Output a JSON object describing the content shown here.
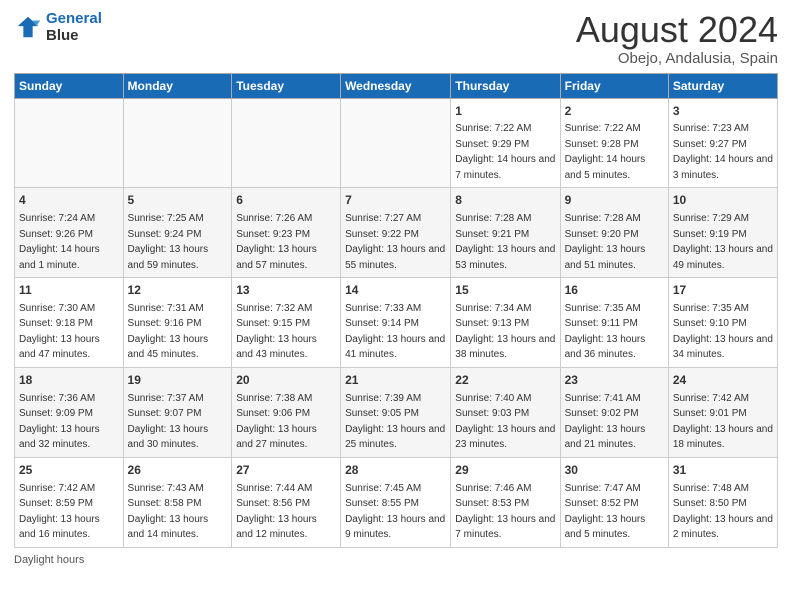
{
  "logo": {
    "line1": "General",
    "line2": "Blue"
  },
  "title": "August 2024",
  "subtitle": "Obejo, Andalusia, Spain",
  "weekdays": [
    "Sunday",
    "Monday",
    "Tuesday",
    "Wednesday",
    "Thursday",
    "Friday",
    "Saturday"
  ],
  "footer": "Daylight hours",
  "weeks": [
    [
      {
        "day": "",
        "sunrise": "",
        "sunset": "",
        "daylight": ""
      },
      {
        "day": "",
        "sunrise": "",
        "sunset": "",
        "daylight": ""
      },
      {
        "day": "",
        "sunrise": "",
        "sunset": "",
        "daylight": ""
      },
      {
        "day": "",
        "sunrise": "",
        "sunset": "",
        "daylight": ""
      },
      {
        "day": "1",
        "sunrise": "Sunrise: 7:22 AM",
        "sunset": "Sunset: 9:29 PM",
        "daylight": "Daylight: 14 hours and 7 minutes."
      },
      {
        "day": "2",
        "sunrise": "Sunrise: 7:22 AM",
        "sunset": "Sunset: 9:28 PM",
        "daylight": "Daylight: 14 hours and 5 minutes."
      },
      {
        "day": "3",
        "sunrise": "Sunrise: 7:23 AM",
        "sunset": "Sunset: 9:27 PM",
        "daylight": "Daylight: 14 hours and 3 minutes."
      }
    ],
    [
      {
        "day": "4",
        "sunrise": "Sunrise: 7:24 AM",
        "sunset": "Sunset: 9:26 PM",
        "daylight": "Daylight: 14 hours and 1 minute."
      },
      {
        "day": "5",
        "sunrise": "Sunrise: 7:25 AM",
        "sunset": "Sunset: 9:24 PM",
        "daylight": "Daylight: 13 hours and 59 minutes."
      },
      {
        "day": "6",
        "sunrise": "Sunrise: 7:26 AM",
        "sunset": "Sunset: 9:23 PM",
        "daylight": "Daylight: 13 hours and 57 minutes."
      },
      {
        "day": "7",
        "sunrise": "Sunrise: 7:27 AM",
        "sunset": "Sunset: 9:22 PM",
        "daylight": "Daylight: 13 hours and 55 minutes."
      },
      {
        "day": "8",
        "sunrise": "Sunrise: 7:28 AM",
        "sunset": "Sunset: 9:21 PM",
        "daylight": "Daylight: 13 hours and 53 minutes."
      },
      {
        "day": "9",
        "sunrise": "Sunrise: 7:28 AM",
        "sunset": "Sunset: 9:20 PM",
        "daylight": "Daylight: 13 hours and 51 minutes."
      },
      {
        "day": "10",
        "sunrise": "Sunrise: 7:29 AM",
        "sunset": "Sunset: 9:19 PM",
        "daylight": "Daylight: 13 hours and 49 minutes."
      }
    ],
    [
      {
        "day": "11",
        "sunrise": "Sunrise: 7:30 AM",
        "sunset": "Sunset: 9:18 PM",
        "daylight": "Daylight: 13 hours and 47 minutes."
      },
      {
        "day": "12",
        "sunrise": "Sunrise: 7:31 AM",
        "sunset": "Sunset: 9:16 PM",
        "daylight": "Daylight: 13 hours and 45 minutes."
      },
      {
        "day": "13",
        "sunrise": "Sunrise: 7:32 AM",
        "sunset": "Sunset: 9:15 PM",
        "daylight": "Daylight: 13 hours and 43 minutes."
      },
      {
        "day": "14",
        "sunrise": "Sunrise: 7:33 AM",
        "sunset": "Sunset: 9:14 PM",
        "daylight": "Daylight: 13 hours and 41 minutes."
      },
      {
        "day": "15",
        "sunrise": "Sunrise: 7:34 AM",
        "sunset": "Sunset: 9:13 PM",
        "daylight": "Daylight: 13 hours and 38 minutes."
      },
      {
        "day": "16",
        "sunrise": "Sunrise: 7:35 AM",
        "sunset": "Sunset: 9:11 PM",
        "daylight": "Daylight: 13 hours and 36 minutes."
      },
      {
        "day": "17",
        "sunrise": "Sunrise: 7:35 AM",
        "sunset": "Sunset: 9:10 PM",
        "daylight": "Daylight: 13 hours and 34 minutes."
      }
    ],
    [
      {
        "day": "18",
        "sunrise": "Sunrise: 7:36 AM",
        "sunset": "Sunset: 9:09 PM",
        "daylight": "Daylight: 13 hours and 32 minutes."
      },
      {
        "day": "19",
        "sunrise": "Sunrise: 7:37 AM",
        "sunset": "Sunset: 9:07 PM",
        "daylight": "Daylight: 13 hours and 30 minutes."
      },
      {
        "day": "20",
        "sunrise": "Sunrise: 7:38 AM",
        "sunset": "Sunset: 9:06 PM",
        "daylight": "Daylight: 13 hours and 27 minutes."
      },
      {
        "day": "21",
        "sunrise": "Sunrise: 7:39 AM",
        "sunset": "Sunset: 9:05 PM",
        "daylight": "Daylight: 13 hours and 25 minutes."
      },
      {
        "day": "22",
        "sunrise": "Sunrise: 7:40 AM",
        "sunset": "Sunset: 9:03 PM",
        "daylight": "Daylight: 13 hours and 23 minutes."
      },
      {
        "day": "23",
        "sunrise": "Sunrise: 7:41 AM",
        "sunset": "Sunset: 9:02 PM",
        "daylight": "Daylight: 13 hours and 21 minutes."
      },
      {
        "day": "24",
        "sunrise": "Sunrise: 7:42 AM",
        "sunset": "Sunset: 9:01 PM",
        "daylight": "Daylight: 13 hours and 18 minutes."
      }
    ],
    [
      {
        "day": "25",
        "sunrise": "Sunrise: 7:42 AM",
        "sunset": "Sunset: 8:59 PM",
        "daylight": "Daylight: 13 hours and 16 minutes."
      },
      {
        "day": "26",
        "sunrise": "Sunrise: 7:43 AM",
        "sunset": "Sunset: 8:58 PM",
        "daylight": "Daylight: 13 hours and 14 minutes."
      },
      {
        "day": "27",
        "sunrise": "Sunrise: 7:44 AM",
        "sunset": "Sunset: 8:56 PM",
        "daylight": "Daylight: 13 hours and 12 minutes."
      },
      {
        "day": "28",
        "sunrise": "Sunrise: 7:45 AM",
        "sunset": "Sunset: 8:55 PM",
        "daylight": "Daylight: 13 hours and 9 minutes."
      },
      {
        "day": "29",
        "sunrise": "Sunrise: 7:46 AM",
        "sunset": "Sunset: 8:53 PM",
        "daylight": "Daylight: 13 hours and 7 minutes."
      },
      {
        "day": "30",
        "sunrise": "Sunrise: 7:47 AM",
        "sunset": "Sunset: 8:52 PM",
        "daylight": "Daylight: 13 hours and 5 minutes."
      },
      {
        "day": "31",
        "sunrise": "Sunrise: 7:48 AM",
        "sunset": "Sunset: 8:50 PM",
        "daylight": "Daylight: 13 hours and 2 minutes."
      }
    ]
  ]
}
